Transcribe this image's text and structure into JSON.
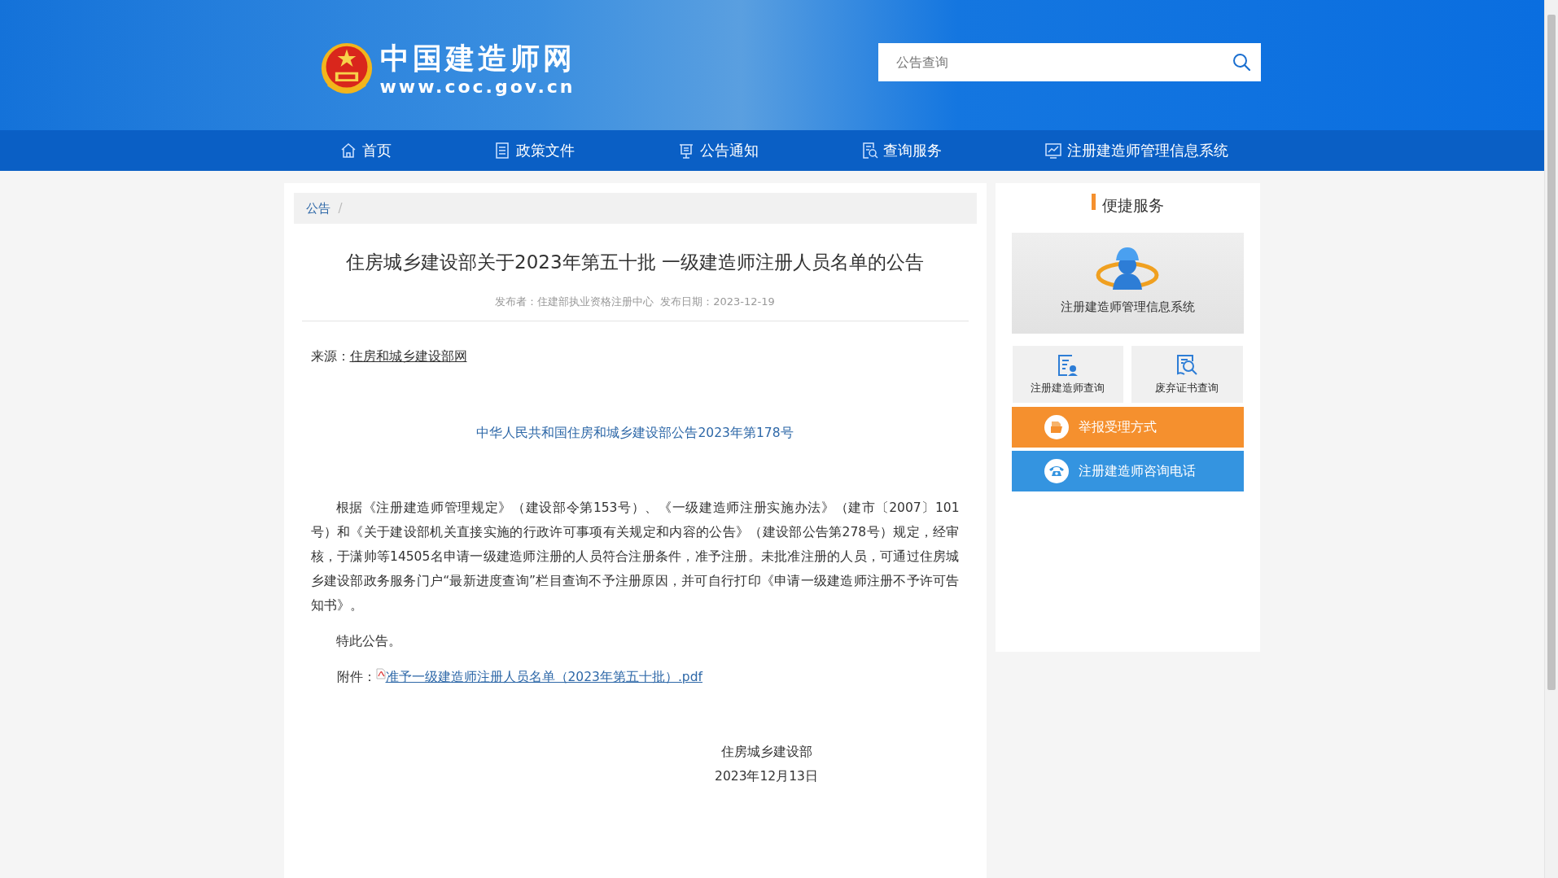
{
  "header": {
    "logo": {
      "title": "中国建造师网",
      "url": "www.coc.gov.cn"
    },
    "search": {
      "placeholder": "公告查询"
    }
  },
  "nav": [
    {
      "label": "首页",
      "kind": "home"
    },
    {
      "label": "政策文件",
      "kind": "document"
    },
    {
      "label": "公告通知",
      "kind": "notice"
    },
    {
      "label": "查询服务",
      "kind": "query"
    },
    {
      "label": "注册建造师管理信息系统",
      "kind": "chart"
    }
  ],
  "breadcrumb": {
    "items": [
      "公告"
    ],
    "separator": "/"
  },
  "article": {
    "title": "住房城乡建设部关于2023年第五十批 一级建造师注册人员名单的公告",
    "meta": [
      "发布者：住建部执业资格注册中心",
      "发布日期：2023-12-19"
    ],
    "source": {
      "label": "来源：",
      "link": "住房和城乡建设部网"
    },
    "notice_number": "中华人民共和国住房和城乡建设部公告2023年第178号",
    "paragraphs": [
      "根据《注册建造师管理规定》（建设部令第153号）、《一级建造师注册实施办法》（建市〔2007〕101号）和《关于建设部机关直接实施的行政许可事项有关规定和内容的公告》（建设部公告第278号）规定，经审核，于潇帅等14505名申请一级建造师注册的人员符合注册条件，准予注册。未批准注册的人员，可通过住房城乡建设部政务服务门户“最新进度查询”栏目查询不予注册原因，并可自行打印《申请一级建造师注册不予许可告知书》。",
      "特此公告。"
    ],
    "attachment": {
      "label": "附件：",
      "file": "准予一级建造师注册人员名单（2023年第五十批）.pdf"
    },
    "signature": {
      "org": "住房城乡建设部",
      "date": "2023年12月13日"
    }
  },
  "sidebar": {
    "title": "便捷服务",
    "banner": {
      "label": "注册建造师管理信息系统"
    },
    "tiles": [
      {
        "label": "注册建造师查询",
        "kind": "registry"
      },
      {
        "label": "废弃证书查询",
        "kind": "certificate"
      }
    ],
    "buttons": [
      {
        "label": "举报受理方式",
        "kind": "report",
        "color": "#f5902e"
      },
      {
        "label": "注册建造师咨询电话",
        "kind": "phone",
        "color": "#3494e0"
      }
    ]
  }
}
